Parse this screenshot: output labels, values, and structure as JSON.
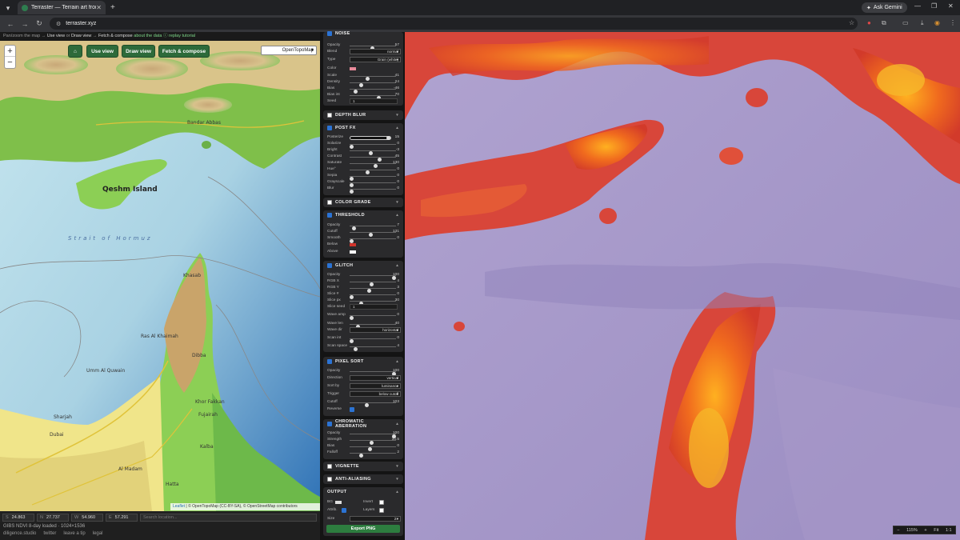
{
  "browser": {
    "tab_title": "Terraster — Terrain art from real...",
    "url": "terraster.xyz",
    "gemini_label": "Ask Gemini"
  },
  "hint": {
    "pan": "Pan/zoom the map →",
    "use_view": "Use view",
    "or": "or",
    "draw_view": "Draw view",
    "arrow": "→",
    "fetch": "Fetch & compose",
    "about": "about the data ⓘ",
    "replay": "replay tutorial"
  },
  "map": {
    "zoom_in": "+",
    "zoom_out": "−",
    "home_icon": "home-icon",
    "use_view_btn": "Use view",
    "draw_view_btn": "Draw view",
    "fetch_btn": "Fetch & compose",
    "basemap": "OpenTopoMap",
    "attribution_leaflet": "Leaflet",
    "attribution_rest": " | © OpenTopoMap (CC-BY-SA), © OpenStreetMap contributors",
    "labels": {
      "bandar": "Bandar Abbas",
      "qeshm": "Qeshm Island",
      "strait": "Strait of Hormuz",
      "khasab": "Khasab",
      "rak": "Ras Al Khaimah",
      "umm": "Umm Al Quwain",
      "sharjah": "Sharjah",
      "dubai": "Dubai",
      "dibba": "Dibba",
      "khor": "Khor Fakkan",
      "fujairah": "Fujairah",
      "kalba": "Kalba",
      "madam": "Al Madam",
      "hatta": "Hatta"
    }
  },
  "coords": {
    "s_label": "S",
    "s": "24.863",
    "n_label": "N",
    "n": "27.737",
    "w_label": "W",
    "w": "54.960",
    "e_label": "E",
    "e": "57.291",
    "search_placeholder": "Search location..."
  },
  "status": {
    "line": "GIBS NDVI 8-day loaded · 1024×1536",
    "links": [
      "diligence.studio",
      "twitter",
      "leave a tip",
      "legal"
    ]
  },
  "panel": {
    "noise": {
      "title": "NOISE",
      "opacity": {
        "label": "Opacity",
        "value": "57"
      },
      "blend": {
        "label": "Blend",
        "value": "normal"
      },
      "type": {
        "label": "Type",
        "value": "Grain (white)"
      },
      "color": {
        "label": "Color",
        "hex": "#e88a9a"
      },
      "scale": {
        "label": "Scale",
        "value": "41"
      },
      "density": {
        "label": "Density",
        "value": "24"
      },
      "bias": {
        "label": "Bias",
        "value": "-46"
      },
      "bias_int": {
        "label": "Bias int",
        "value": "70"
      },
      "seed": {
        "label": "Seed",
        "value": "1"
      }
    },
    "depth_blur": {
      "title": "DEPTH BLUR"
    },
    "post_fx": {
      "title": "POST FX",
      "posterize": {
        "label": "Posterize",
        "value": "15"
      },
      "solarize": {
        "label": "Solarize",
        "value": "0"
      },
      "bright": {
        "label": "Bright",
        "value": "-3"
      },
      "contrast": {
        "label": "Contrast",
        "value": "45"
      },
      "saturate": {
        "label": "Saturate",
        "value": "130"
      },
      "hue": {
        "label": "Hue°",
        "value": "0"
      },
      "sepia": {
        "label": "Sepia",
        "value": "0"
      },
      "grayscale": {
        "label": "Grayscale",
        "value": "0"
      },
      "blur": {
        "label": "Blur",
        "value": "0"
      }
    },
    "color_grade": {
      "title": "COLOR GRADE"
    },
    "threshold": {
      "title": "THRESHOLD",
      "opacity": {
        "label": "Opacity",
        "value": "7"
      },
      "cutoff": {
        "label": "Cutoff",
        "value": "131"
      },
      "smooth": {
        "label": "Smooth",
        "value": "0"
      },
      "below": {
        "label": "Below",
        "hex": "#d0342c"
      },
      "above": {
        "label": "Above",
        "hex": "#ffffff"
      }
    },
    "glitch": {
      "title": "GLITCH",
      "opacity": {
        "label": "Opacity",
        "value": "100"
      },
      "rgbx": {
        "label": "RGB X",
        "value": "4"
      },
      "rgby": {
        "label": "RGB Y",
        "value": "3"
      },
      "slice_n": {
        "label": "Slice #",
        "value": "0"
      },
      "slice_px": {
        "label": "Slice px",
        "value": "30"
      },
      "slice_seed": {
        "label": "Slice seed",
        "value": "1"
      },
      "wave_amp": {
        "label": "Wave amp",
        "value": "0"
      },
      "wave_len": {
        "label": "Wave len",
        "value": "40"
      },
      "wave_dir": {
        "label": "Wave dir",
        "value": "horizontal"
      },
      "scan_int": {
        "label": "Scan int",
        "value": "0"
      },
      "scan_space": {
        "label": "Scan space",
        "value": "4"
      }
    },
    "pixel_sort": {
      "title": "PIXEL SORT",
      "opacity": {
        "label": "Opacity",
        "value": "100"
      },
      "direction": {
        "label": "Direction",
        "value": "vertical"
      },
      "sort_by": {
        "label": "Sort by",
        "value": "luminance"
      },
      "trigger": {
        "label": "Trigger",
        "value": "below cutoff"
      },
      "cutoff": {
        "label": "Cutoff",
        "value": "103"
      },
      "reverse": {
        "label": "Reverse"
      }
    },
    "chromatic": {
      "title": "CHROMATIC ABERRATION",
      "opacity": {
        "label": "Opacity",
        "value": "100"
      },
      "strength": {
        "label": "Strength",
        "value": "10.5"
      },
      "bias": {
        "label": "Bias",
        "value": "0"
      },
      "falloff": {
        "label": "Falloff",
        "value": "2"
      }
    },
    "vignette": {
      "title": "VIGNETTE"
    },
    "anti_aliasing": {
      "title": "ANTI-ALIASING"
    },
    "output": {
      "title": "OUTPUT",
      "bg": {
        "label": "BG"
      },
      "invert": {
        "label": "Invert"
      },
      "attrib": {
        "label": "Attrib."
      },
      "layers": {
        "label": "Layers"
      },
      "size": {
        "label": "Size",
        "value": "2×"
      },
      "export": "Export PNG"
    }
  },
  "canvas_zoom": {
    "minus": "−",
    "level": "115%",
    "plus": "+",
    "fit": "Fit",
    "one": "1:1"
  }
}
